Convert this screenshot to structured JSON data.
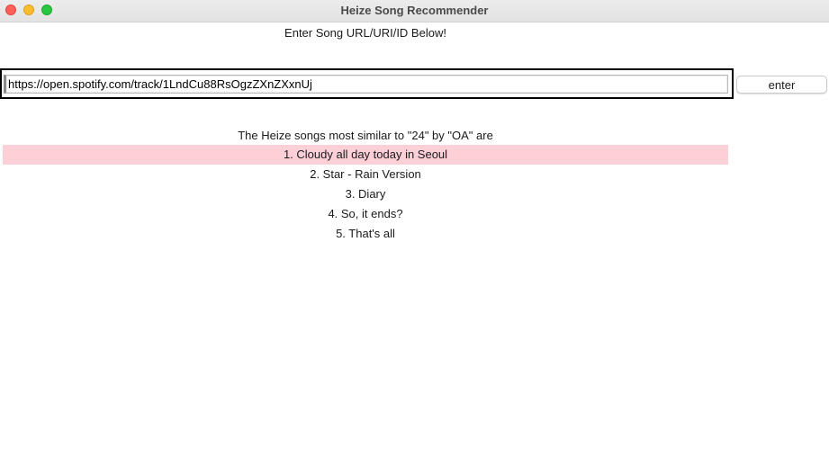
{
  "window": {
    "title": "Heize Song Recommender"
  },
  "prompt": "Enter Song URL/URI/ID Below!",
  "input": {
    "value": "https://open.spotify.com/track/1LndCu88RsOgzZXnZXxnUj"
  },
  "enter_button": {
    "label": "enter"
  },
  "results": {
    "heading": "The Heize songs most similar to \"24\" by \"OA\" are",
    "selected_index": 0,
    "selected_color": "#fdd0d8",
    "items": [
      "1. Cloudy all day today in Seoul",
      "2. Star - Rain Version",
      "3. Diary",
      "4. So, it ends?",
      "5. That's all"
    ]
  }
}
